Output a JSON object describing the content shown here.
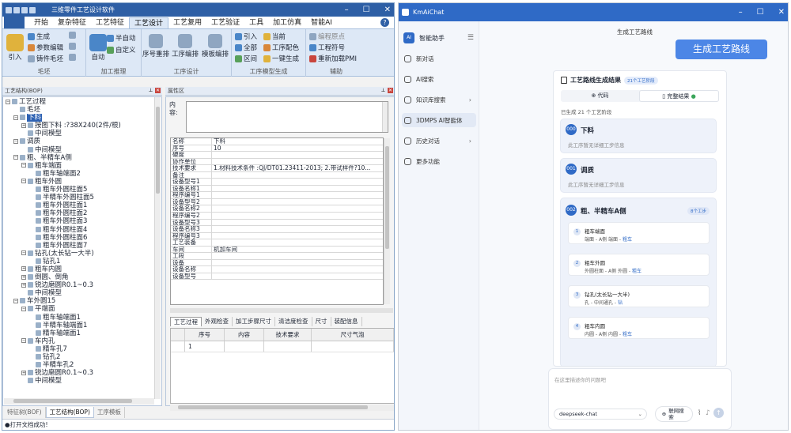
{
  "left_window": {
    "title": "三维零件工艺设计软件",
    "menu_tabs": [
      "开始",
      "复杂特征",
      "工艺特征",
      "工艺设计",
      "工艺复用",
      "工艺验证",
      "工具",
      "加工仿真",
      "智能AI"
    ],
    "active_tab": "工艺设计",
    "ribbon": {
      "group_maopi": {
        "label": "毛坯",
        "import": "引入",
        "generate": "生成",
        "param_edit": "参数编辑",
        "casting": "铸件毛坯"
      },
      "group_reasoning": {
        "label": "加工推理",
        "auto": "自动",
        "semi_auto": "半自动",
        "custom": "自定义"
      },
      "group_design": {
        "label": "工序设计",
        "reorder": "序号重排",
        "step_edit": "工序编排",
        "template_edit": "模板编排"
      },
      "group_model": {
        "label": "工序模型生成",
        "import": "引入",
        "current": "当前",
        "all": "全部",
        "color": "工序配色",
        "region": "区间",
        "one_click": "一键生成"
      },
      "group_assist": {
        "label": "辅助",
        "prog_origin": "编程原点",
        "process_symbol": "工程符号",
        "reload_pmi": "重新加载PMI"
      }
    },
    "tree_panel_title": "工艺结构(BOP)",
    "tree": [
      {
        "level": 0,
        "exp": "⊟",
        "text": "工艺过程"
      },
      {
        "level": 1,
        "exp": "",
        "text": "毛坯"
      },
      {
        "level": 1,
        "exp": "⊟",
        "text": "下料",
        "selected": true
      },
      {
        "level": 2,
        "exp": "⊞",
        "text": "按图下料 :?38X240(2件/根)"
      },
      {
        "level": 2,
        "exp": "",
        "text": "中间模型"
      },
      {
        "level": 1,
        "exp": "⊟",
        "text": "调质"
      },
      {
        "level": 2,
        "exp": "",
        "text": "中间模型"
      },
      {
        "level": 1,
        "exp": "⊟",
        "text": "粗、半精车A侧"
      },
      {
        "level": 2,
        "exp": "⊟",
        "text": "粗车端面"
      },
      {
        "level": 3,
        "exp": "",
        "text": "粗车轴端面2"
      },
      {
        "level": 2,
        "exp": "⊟",
        "text": "粗车外圆"
      },
      {
        "level": 3,
        "exp": "",
        "text": "粗车外圆柱面5"
      },
      {
        "level": 3,
        "exp": "",
        "text": "半精车外圆柱面5"
      },
      {
        "level": 3,
        "exp": "",
        "text": "粗车外圆柱面1"
      },
      {
        "level": 3,
        "exp": "",
        "text": "粗车外圆柱面2"
      },
      {
        "level": 3,
        "exp": "",
        "text": "粗车外圆柱面3"
      },
      {
        "level": 3,
        "exp": "",
        "text": "粗车外圆柱面4"
      },
      {
        "level": 3,
        "exp": "",
        "text": "粗车外圆柱面6"
      },
      {
        "level": 3,
        "exp": "",
        "text": "粗车外圆柱面7"
      },
      {
        "level": 2,
        "exp": "⊟",
        "text": "钻孔(太长钻一大半)"
      },
      {
        "level": 3,
        "exp": "",
        "text": "钻孔1"
      },
      {
        "level": 2,
        "exp": "⊞",
        "text": "粗车内圆"
      },
      {
        "level": 2,
        "exp": "⊞",
        "text": "倒圆、倒角"
      },
      {
        "level": 2,
        "exp": "⊞",
        "text": "锐边磨圆R0.1~0.3"
      },
      {
        "level": 2,
        "exp": "",
        "text": "中间模型"
      },
      {
        "level": 1,
        "exp": "⊟",
        "text": "车外圆15"
      },
      {
        "level": 2,
        "exp": "⊟",
        "text": "平端面"
      },
      {
        "level": 3,
        "exp": "",
        "text": "粗车轴端面1"
      },
      {
        "level": 3,
        "exp": "",
        "text": "半精车轴端面1"
      },
      {
        "level": 3,
        "exp": "",
        "text": "精车轴端面1"
      },
      {
        "level": 2,
        "exp": "⊟",
        "text": "车内孔"
      },
      {
        "level": 3,
        "exp": "",
        "text": "精车孔7"
      },
      {
        "level": 3,
        "exp": "",
        "text": "钻孔2"
      },
      {
        "level": 3,
        "exp": "",
        "text": "半精车孔2"
      },
      {
        "level": 2,
        "exp": "⊞",
        "text": "锐边磨圆R0.1~0.3"
      },
      {
        "level": 2,
        "exp": "",
        "text": "中间模型"
      }
    ],
    "bottom_tabs": [
      "特征树(BOF)",
      "工艺结构(BOP)",
      "工序模板"
    ],
    "active_bottom_tab": "工艺结构(BOP)",
    "attr_panel_title": "属性区",
    "content_label": "内容:",
    "properties": [
      [
        "名称",
        "下料"
      ],
      [
        "序号",
        "10"
      ],
      [
        "硬度",
        ""
      ],
      [
        "协作单位",
        ""
      ],
      [
        "技术要求",
        "1.材料技术条件 :QJ/DT01.23411-2013; 2.带试样件?10..."
      ],
      [
        "备注",
        ""
      ],
      [
        "设备型号1",
        ""
      ],
      [
        "设备名称1",
        ""
      ],
      [
        "程序编号1",
        ""
      ],
      [
        "设备型号2",
        ""
      ],
      [
        "设备名称2",
        ""
      ],
      [
        "程序编号2",
        ""
      ],
      [
        "设备型号3",
        ""
      ],
      [
        "设备名称3",
        ""
      ],
      [
        "程序编号3",
        ""
      ],
      [
        "工艺装备",
        ""
      ],
      [
        "车间",
        "机加车间"
      ],
      [
        "工段",
        ""
      ],
      [
        "设备",
        ""
      ],
      [
        "设备名称",
        ""
      ],
      [
        "设备型号",
        ""
      ]
    ],
    "sub_tabs": [
      "工艺过程",
      "外观检查",
      "加工步骤尺寸",
      "清洁度检查",
      "尺寸",
      "装配信息"
    ],
    "active_sub_tab": "工艺过程",
    "step_columns": [
      "序号",
      "内容",
      "技术要求",
      "尺寸气泡"
    ],
    "step_rows": [
      [
        "1",
        "",
        "",
        ""
      ]
    ],
    "status": "●打开文档成功!"
  },
  "right_window": {
    "title": "KmAiChat",
    "sidebar": {
      "header": "智能助手",
      "items": [
        {
          "label": "新对话"
        },
        {
          "label": "AI搜索"
        },
        {
          "label": "知识库搜索",
          "chevron": true
        },
        {
          "label": "3DMPS AI智能体",
          "active": true
        },
        {
          "label": "历史对话",
          "chevron": true
        },
        {
          "label": "更多功能"
        }
      ]
    },
    "chat_title": "生成工艺路线",
    "user_message": "生成工艺路线",
    "result": {
      "title": "工艺路线生成结果",
      "badge": "21个工艺阶段",
      "tab_code": "代码",
      "tab_full": "完整结果",
      "summary": "已生成 21 个工艺阶段",
      "stages": [
        {
          "num": "000",
          "name": "下料",
          "desc": "此工序暂无详细工步信息"
        },
        {
          "num": "001",
          "name": "调质",
          "desc": "此工序暂无详细工步信息"
        },
        {
          "num": "002",
          "name": "粗、半精车A侧",
          "badge": "8个工步",
          "steps": [
            {
              "n": "1",
              "name": "粗车端面",
              "detail": "端面 - A侧 端面 - ",
              "tag": "粗车"
            },
            {
              "n": "2",
              "name": "粗车外圆",
              "detail": "外圆柱面 - A侧 外圆 - ",
              "tag": "粗车"
            },
            {
              "n": "3",
              "name": "钻孔(太长钻一大半)",
              "detail": "孔 - 中间通孔 - ",
              "tag": "钻"
            },
            {
              "n": "4",
              "name": "粗车内圆",
              "detail": "内圆 - A侧 内圆 - ",
              "tag": "粗车"
            }
          ]
        }
      ]
    },
    "input_placeholder": "在这里描述你的问题吧",
    "model": "deepseek-chat",
    "web_search": "联网搜索"
  }
}
